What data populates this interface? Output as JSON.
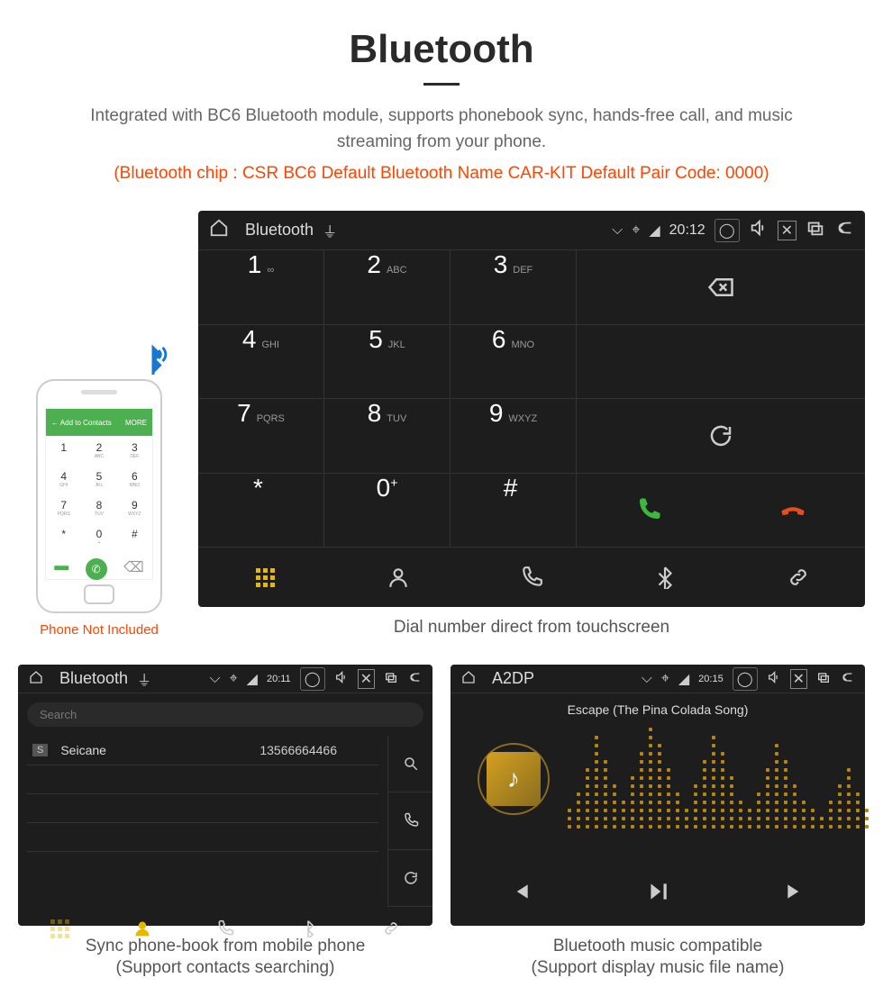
{
  "header": {
    "title": "Bluetooth",
    "subtitle": "Integrated with BC6 Bluetooth module, supports phonebook sync, hands-free call, and music streaming from your phone.",
    "specs": "(Bluetooth chip : CSR BC6     Default Bluetooth Name CAR-KIT     Default Pair Code: 0000)"
  },
  "phone": {
    "note": "Phone Not Included",
    "top_label": "Add to Contacts",
    "top_right": "MORE"
  },
  "main_device": {
    "statusbar": {
      "label": "Bluetooth",
      "time": "20:12"
    },
    "keypad": [
      {
        "digit": "1",
        "letters": "∞"
      },
      {
        "digit": "2",
        "letters": "ABC"
      },
      {
        "digit": "3",
        "letters": "DEF"
      },
      {
        "digit": "4",
        "letters": "GHI"
      },
      {
        "digit": "5",
        "letters": "JKL"
      },
      {
        "digit": "6",
        "letters": "MNO"
      },
      {
        "digit": "7",
        "letters": "PQRS"
      },
      {
        "digit": "8",
        "letters": "TUV"
      },
      {
        "digit": "9",
        "letters": "WXYZ"
      },
      {
        "digit": "*",
        "letters": ""
      },
      {
        "digit": "0",
        "letters": "+",
        "sup": true
      },
      {
        "digit": "#",
        "letters": ""
      }
    ],
    "caption": "Dial number direct from touchscreen"
  },
  "contacts_device": {
    "statusbar": {
      "label": "Bluetooth",
      "time": "20:11"
    },
    "search_placeholder": "Search",
    "contact": {
      "badge": "S",
      "name": "Seicane",
      "number": "13566664466"
    },
    "caption_l1": "Sync phone-book from mobile phone",
    "caption_l2": "(Support contacts searching)"
  },
  "music_device": {
    "statusbar": {
      "label": "A2DP",
      "time": "20:15"
    },
    "song": "Escape (The Pina Colada Song)",
    "caption_l1": "Bluetooth music compatible",
    "caption_l2": "(Support display music file name)"
  },
  "viz_heights": [
    3,
    5,
    8,
    12,
    9,
    6,
    4,
    7,
    10,
    13,
    11,
    8,
    5,
    3,
    6,
    9,
    12,
    10,
    7,
    4,
    3,
    5,
    8,
    11,
    9,
    6,
    4,
    3,
    2,
    4,
    6,
    8,
    5,
    3
  ]
}
